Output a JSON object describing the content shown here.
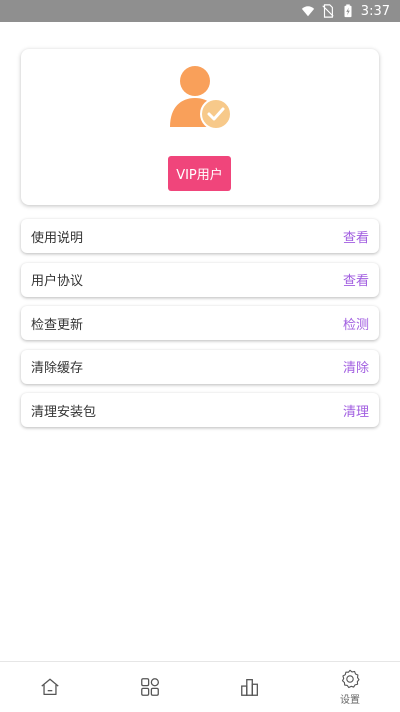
{
  "status_bar": {
    "time": "3:37",
    "icons": [
      "wifi-icon",
      "no-sim-icon",
      "battery-charging-icon"
    ]
  },
  "profile": {
    "avatar_icon": "user-verified-icon",
    "avatar_color": "#f9a05a",
    "badge_color": "#f7c98a",
    "vip_label": "VIP用户",
    "vip_color": "#f0457b"
  },
  "menu": {
    "action_color": "#a15ee0",
    "items": [
      {
        "label": "使用说明",
        "action": "查看"
      },
      {
        "label": "用户协议",
        "action": "查看"
      },
      {
        "label": "检查更新",
        "action": "检测"
      },
      {
        "label": "清除缓存",
        "action": "清除"
      },
      {
        "label": "清理安装包",
        "action": "清理"
      }
    ]
  },
  "tab_bar": {
    "tabs": [
      {
        "icon": "home-icon",
        "label": ""
      },
      {
        "icon": "apps-icon",
        "label": ""
      },
      {
        "icon": "chart-icon",
        "label": ""
      },
      {
        "icon": "settings-icon",
        "label": "设置"
      }
    ]
  }
}
